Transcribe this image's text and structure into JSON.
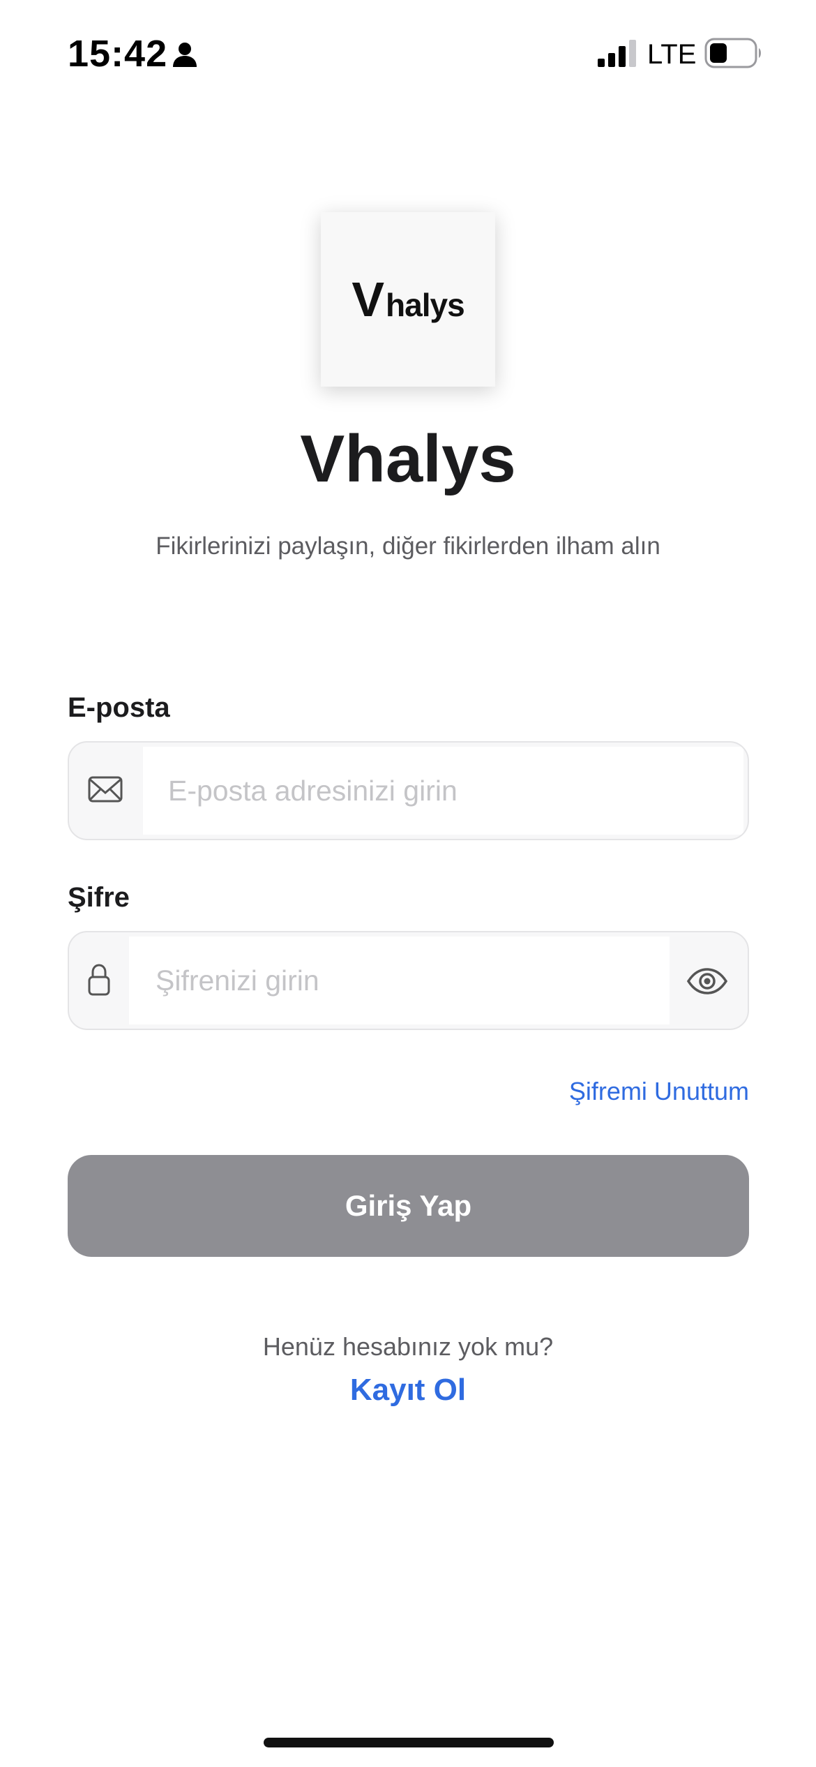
{
  "status_bar": {
    "time": "15:42",
    "network": "LTE",
    "icons": [
      "person-icon",
      "signal-icon",
      "battery-icon"
    ]
  },
  "logo": {
    "mark_v": "V",
    "mark_rest": "halys"
  },
  "app": {
    "title": "Vhalys",
    "subtitle": "Fikirlerinizi paylaşın, diğer fikirlerden ilham alın"
  },
  "form": {
    "email": {
      "label": "E-posta",
      "placeholder": "E-posta adresinizi girin",
      "value": "",
      "icon": "mail-icon"
    },
    "password": {
      "label": "Şifre",
      "placeholder": "Şifrenizi girin",
      "value": "",
      "icon": "lock-icon",
      "toggle_icon": "eye-icon"
    },
    "forgot_password": "Şifremi Unuttum",
    "login_button": "Giriş Yap"
  },
  "footer": {
    "question": "Henüz hesabınız yok mu?",
    "register": "Kayıt Ol"
  },
  "colors": {
    "accent": "#2f6be0",
    "button_disabled": "#8e8e93",
    "text_primary": "#1c1c1e",
    "text_secondary": "#5c5c60",
    "placeholder": "#c4c4c7"
  }
}
